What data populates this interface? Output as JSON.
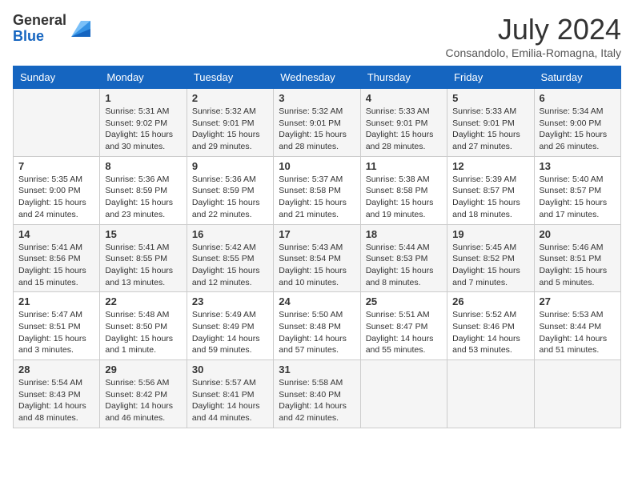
{
  "header": {
    "logo_line1": "General",
    "logo_line2": "Blue",
    "month": "July 2024",
    "location": "Consandolo, Emilia-Romagna, Italy"
  },
  "days_of_week": [
    "Sunday",
    "Monday",
    "Tuesday",
    "Wednesday",
    "Thursday",
    "Friday",
    "Saturday"
  ],
  "weeks": [
    [
      {
        "day": "",
        "info": ""
      },
      {
        "day": "1",
        "info": "Sunrise: 5:31 AM\nSunset: 9:02 PM\nDaylight: 15 hours\nand 30 minutes."
      },
      {
        "day": "2",
        "info": "Sunrise: 5:32 AM\nSunset: 9:01 PM\nDaylight: 15 hours\nand 29 minutes."
      },
      {
        "day": "3",
        "info": "Sunrise: 5:32 AM\nSunset: 9:01 PM\nDaylight: 15 hours\nand 28 minutes."
      },
      {
        "day": "4",
        "info": "Sunrise: 5:33 AM\nSunset: 9:01 PM\nDaylight: 15 hours\nand 28 minutes."
      },
      {
        "day": "5",
        "info": "Sunrise: 5:33 AM\nSunset: 9:01 PM\nDaylight: 15 hours\nand 27 minutes."
      },
      {
        "day": "6",
        "info": "Sunrise: 5:34 AM\nSunset: 9:00 PM\nDaylight: 15 hours\nand 26 minutes."
      }
    ],
    [
      {
        "day": "7",
        "info": "Sunrise: 5:35 AM\nSunset: 9:00 PM\nDaylight: 15 hours\nand 24 minutes."
      },
      {
        "day": "8",
        "info": "Sunrise: 5:36 AM\nSunset: 8:59 PM\nDaylight: 15 hours\nand 23 minutes."
      },
      {
        "day": "9",
        "info": "Sunrise: 5:36 AM\nSunset: 8:59 PM\nDaylight: 15 hours\nand 22 minutes."
      },
      {
        "day": "10",
        "info": "Sunrise: 5:37 AM\nSunset: 8:58 PM\nDaylight: 15 hours\nand 21 minutes."
      },
      {
        "day": "11",
        "info": "Sunrise: 5:38 AM\nSunset: 8:58 PM\nDaylight: 15 hours\nand 19 minutes."
      },
      {
        "day": "12",
        "info": "Sunrise: 5:39 AM\nSunset: 8:57 PM\nDaylight: 15 hours\nand 18 minutes."
      },
      {
        "day": "13",
        "info": "Sunrise: 5:40 AM\nSunset: 8:57 PM\nDaylight: 15 hours\nand 17 minutes."
      }
    ],
    [
      {
        "day": "14",
        "info": "Sunrise: 5:41 AM\nSunset: 8:56 PM\nDaylight: 15 hours\nand 15 minutes."
      },
      {
        "day": "15",
        "info": "Sunrise: 5:41 AM\nSunset: 8:55 PM\nDaylight: 15 hours\nand 13 minutes."
      },
      {
        "day": "16",
        "info": "Sunrise: 5:42 AM\nSunset: 8:55 PM\nDaylight: 15 hours\nand 12 minutes."
      },
      {
        "day": "17",
        "info": "Sunrise: 5:43 AM\nSunset: 8:54 PM\nDaylight: 15 hours\nand 10 minutes."
      },
      {
        "day": "18",
        "info": "Sunrise: 5:44 AM\nSunset: 8:53 PM\nDaylight: 15 hours\nand 8 minutes."
      },
      {
        "day": "19",
        "info": "Sunrise: 5:45 AM\nSunset: 8:52 PM\nDaylight: 15 hours\nand 7 minutes."
      },
      {
        "day": "20",
        "info": "Sunrise: 5:46 AM\nSunset: 8:51 PM\nDaylight: 15 hours\nand 5 minutes."
      }
    ],
    [
      {
        "day": "21",
        "info": "Sunrise: 5:47 AM\nSunset: 8:51 PM\nDaylight: 15 hours\nand 3 minutes."
      },
      {
        "day": "22",
        "info": "Sunrise: 5:48 AM\nSunset: 8:50 PM\nDaylight: 15 hours\nand 1 minute."
      },
      {
        "day": "23",
        "info": "Sunrise: 5:49 AM\nSunset: 8:49 PM\nDaylight: 14 hours\nand 59 minutes."
      },
      {
        "day": "24",
        "info": "Sunrise: 5:50 AM\nSunset: 8:48 PM\nDaylight: 14 hours\nand 57 minutes."
      },
      {
        "day": "25",
        "info": "Sunrise: 5:51 AM\nSunset: 8:47 PM\nDaylight: 14 hours\nand 55 minutes."
      },
      {
        "day": "26",
        "info": "Sunrise: 5:52 AM\nSunset: 8:46 PM\nDaylight: 14 hours\nand 53 minutes."
      },
      {
        "day": "27",
        "info": "Sunrise: 5:53 AM\nSunset: 8:44 PM\nDaylight: 14 hours\nand 51 minutes."
      }
    ],
    [
      {
        "day": "28",
        "info": "Sunrise: 5:54 AM\nSunset: 8:43 PM\nDaylight: 14 hours\nand 48 minutes."
      },
      {
        "day": "29",
        "info": "Sunrise: 5:56 AM\nSunset: 8:42 PM\nDaylight: 14 hours\nand 46 minutes."
      },
      {
        "day": "30",
        "info": "Sunrise: 5:57 AM\nSunset: 8:41 PM\nDaylight: 14 hours\nand 44 minutes."
      },
      {
        "day": "31",
        "info": "Sunrise: 5:58 AM\nSunset: 8:40 PM\nDaylight: 14 hours\nand 42 minutes."
      },
      {
        "day": "",
        "info": ""
      },
      {
        "day": "",
        "info": ""
      },
      {
        "day": "",
        "info": ""
      }
    ]
  ]
}
